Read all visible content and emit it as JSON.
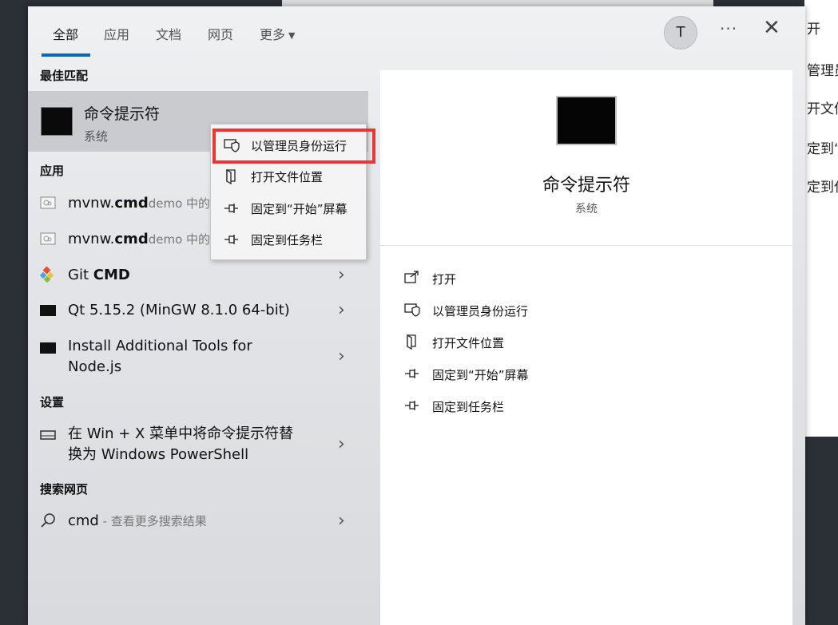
{
  "background": {
    "right_fragments": [
      "开",
      "管理员",
      "开文件",
      "定到“开",
      "定到任"
    ]
  },
  "tabs": [
    {
      "label": "全部",
      "active": true
    },
    {
      "label": "应用"
    },
    {
      "label": "文档"
    },
    {
      "label": "网页"
    },
    {
      "label": "更多"
    }
  ],
  "header": {
    "avatar_letter": "T",
    "more_glyph": "···",
    "close_glyph": "✕"
  },
  "best_match": {
    "heading": "最佳匹配",
    "title": "命令提示符",
    "subtitle": "系统"
  },
  "apps": {
    "heading": "应用",
    "items": [
      {
        "prefix": "mvnw.",
        "bold": "cmd",
        "suffix": "demo 中的",
        "chevron": false
      },
      {
        "prefix": "mvnw.",
        "bold": "cmd",
        "suffix": "demo 中的",
        "chevron": false
      },
      {
        "prefix": "Git ",
        "bold": "CMD",
        "suffix": "",
        "chevron": true
      },
      {
        "line1": "Qt 5.15.2 (MinGW 8.1.0 64-bit)",
        "chevron": true
      },
      {
        "line1": "Install Additional Tools for",
        "line2": "Node.js",
        "chevron": true
      }
    ]
  },
  "settings": {
    "heading": "设置",
    "item_line1": "在 Win + X 菜单中将命令提示符替",
    "item_line2": "换为 Windows PowerShell"
  },
  "web": {
    "heading": "搜索网页",
    "query": "cmd",
    "hint": " - 查看更多搜索结果"
  },
  "context_menu": [
    {
      "label": "以管理员身份运行",
      "icon": "shield-icon",
      "highlighted": true
    },
    {
      "label": "打开文件位置",
      "icon": "file-location-icon"
    },
    {
      "label": "固定到“开始”屏幕",
      "icon": "pin-icon"
    },
    {
      "label": "固定到任务栏",
      "icon": "pin-icon"
    }
  ],
  "detail": {
    "title": "命令提示符",
    "subtitle": "系统",
    "actions": [
      {
        "label": "打开",
        "icon": "open-icon"
      },
      {
        "label": "以管理员身份运行",
        "icon": "shield-icon"
      },
      {
        "label": "打开文件位置",
        "icon": "file-location-icon"
      },
      {
        "label": "固定到“开始”屏幕",
        "icon": "pin-icon"
      },
      {
        "label": "固定到任务栏",
        "icon": "pin-icon"
      }
    ]
  },
  "colors": {
    "accent": "#0067c0",
    "highlight_border": "#e53935",
    "selected_row": "#c9cbcf"
  }
}
